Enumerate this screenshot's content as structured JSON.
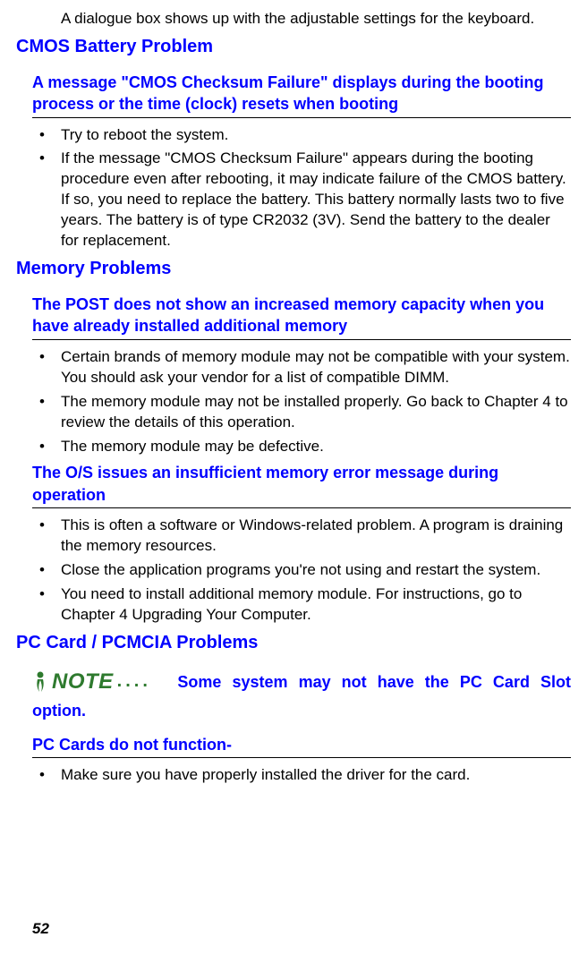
{
  "intro": "A dialogue box shows up with the adjustable settings for the keyboard.",
  "section1": {
    "title": "CMOS Battery Problem",
    "sub1": {
      "heading": "A message \"CMOS Checksum Failure\" displays during the booting process or the time (clock) resets when booting",
      "items": [
        "Try to reboot the system.",
        "If the message \"CMOS Checksum Failure\" appears during the booting procedure even after rebooting, it may indicate failure of the CMOS battery. If so, you need to replace the battery. This battery normally lasts two to five years. The battery is of type CR2032 (3V). Send the battery to the dealer for replacement."
      ]
    }
  },
  "section2": {
    "title": "Memory Problems",
    "sub1": {
      "heading": "The POST does not show an increased memory capacity when you have already installed additional memory",
      "items": [
        "Certain brands of memory module may not be compatible with your system. You should ask your vendor for a list of compatible DIMM.",
        "The memory module may not be installed properly. Go back to Chapter 4 to review the details of this operation.",
        "The memory module may be defective."
      ]
    },
    "sub2": {
      "heading": "The O/S issues an insufficient memory error message during operation",
      "items": [
        "This is often a software or Windows-related problem. A program is draining the memory resources.",
        "Close the application programs you're not using and restart the system.",
        "You need to install additional memory module. For instructions, go to Chapter 4 Upgrading Your Computer."
      ]
    }
  },
  "section3": {
    "title": "PC Card / PCMCIA Problems",
    "note_label": "NOTE",
    "note_dots": "....",
    "note_text": "Some system may not have the PC Card Slot option.",
    "sub1": {
      "heading": "PC Cards do not function-",
      "items": [
        "Make sure you have properly installed the driver for the card."
      ]
    }
  },
  "page_num": "52"
}
